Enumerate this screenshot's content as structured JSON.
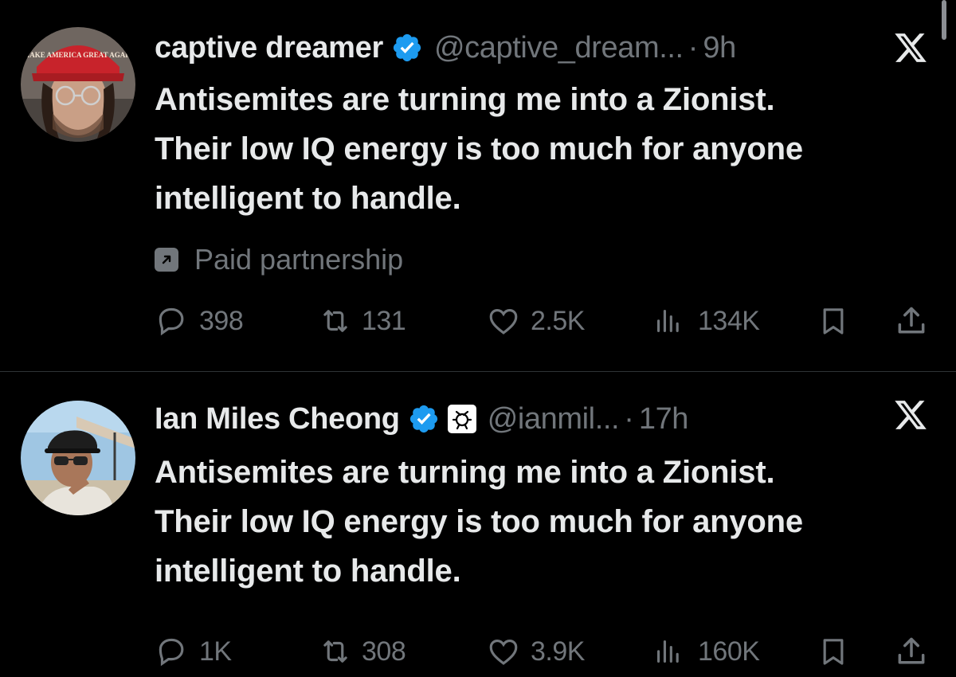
{
  "tweets": [
    {
      "name": "captive dreamer",
      "handle": "@captive_dream...",
      "separator": "·",
      "time": "9h",
      "text_lines": [
        "Antisemites are turning me into a Zionist.",
        "Their low IQ energy is too much for anyone",
        "intelligent to handle."
      ],
      "paid_label": "Paid partnership",
      "hat_text": "MAKE AMERICA GREAT AGAIN",
      "stats": {
        "replies": "398",
        "reposts": "131",
        "likes": "2.5K",
        "views": "134K"
      }
    },
    {
      "name": "Ian Miles Cheong",
      "handle": "@ianmil...",
      "separator": "·",
      "time": "17h",
      "text_lines": [
        "Antisemites are turning me into a Zionist.",
        "Their low IQ energy is too much for anyone",
        "intelligent to handle."
      ],
      "stats": {
        "replies": "1K",
        "reposts": "308",
        "likes": "3.9K",
        "views": "160K"
      }
    }
  ],
  "colors": {
    "background": "#000000",
    "text": "#e7e9ea",
    "muted": "#71767b",
    "verified": "#1d9bf0",
    "divider": "#2f3336"
  },
  "icons": [
    "verified-badge-icon",
    "x-logo-icon",
    "reply-icon",
    "repost-icon",
    "like-icon",
    "views-icon",
    "bookmark-icon",
    "share-icon",
    "paid-partnership-icon",
    "affiliation-badge-icon"
  ]
}
